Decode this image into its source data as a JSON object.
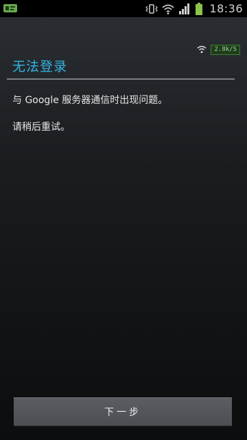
{
  "status_bar": {
    "left_icon": "app-notification-icon",
    "icons": [
      "vibrate-icon",
      "wifi-icon",
      "signal-icon",
      "battery-icon"
    ],
    "time": "18:36"
  },
  "network": {
    "icon": "wifi-icon",
    "speed": "2.8k/S"
  },
  "dialog": {
    "title": "无法登录",
    "message_1": "与 Google 服务器通信时出现问题。",
    "message_2": "请稍后重试。"
  },
  "footer": {
    "next_label": "下一步"
  },
  "colors": {
    "accent": "#33b5e5",
    "battery": "#8bc34a"
  }
}
